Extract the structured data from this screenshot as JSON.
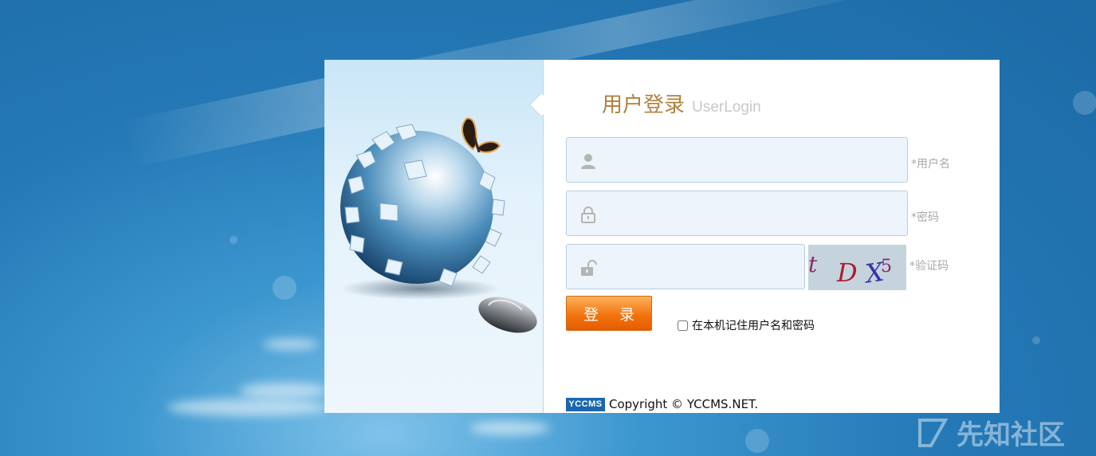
{
  "login": {
    "title_cn": "用户登录",
    "title_en": "UserLogin",
    "username": {
      "value": "",
      "hint": "*用户名"
    },
    "password": {
      "value": "",
      "hint": "*密码"
    },
    "captcha": {
      "value": "",
      "hint": "*验证码",
      "image_text": "t D X 5"
    },
    "submit_label": "登 录",
    "remember_label": "在本机记住用户名和密码"
  },
  "footer": {
    "logo_text": "YCCMS",
    "copyright": "Copyright © YCCMS.NET."
  },
  "watermark": {
    "text": "先知社区"
  },
  "colors": {
    "accent": "#f3740f",
    "title": "#b0803b",
    "field_bg": "#edf4fb",
    "background": "#2479b6"
  },
  "icons": [
    "user-icon",
    "lock-icon",
    "unlock-icon",
    "globe-puzzle-illustration",
    "butterfly-illustration",
    "mouse-illustration",
    "watermark-logo-icon"
  ]
}
